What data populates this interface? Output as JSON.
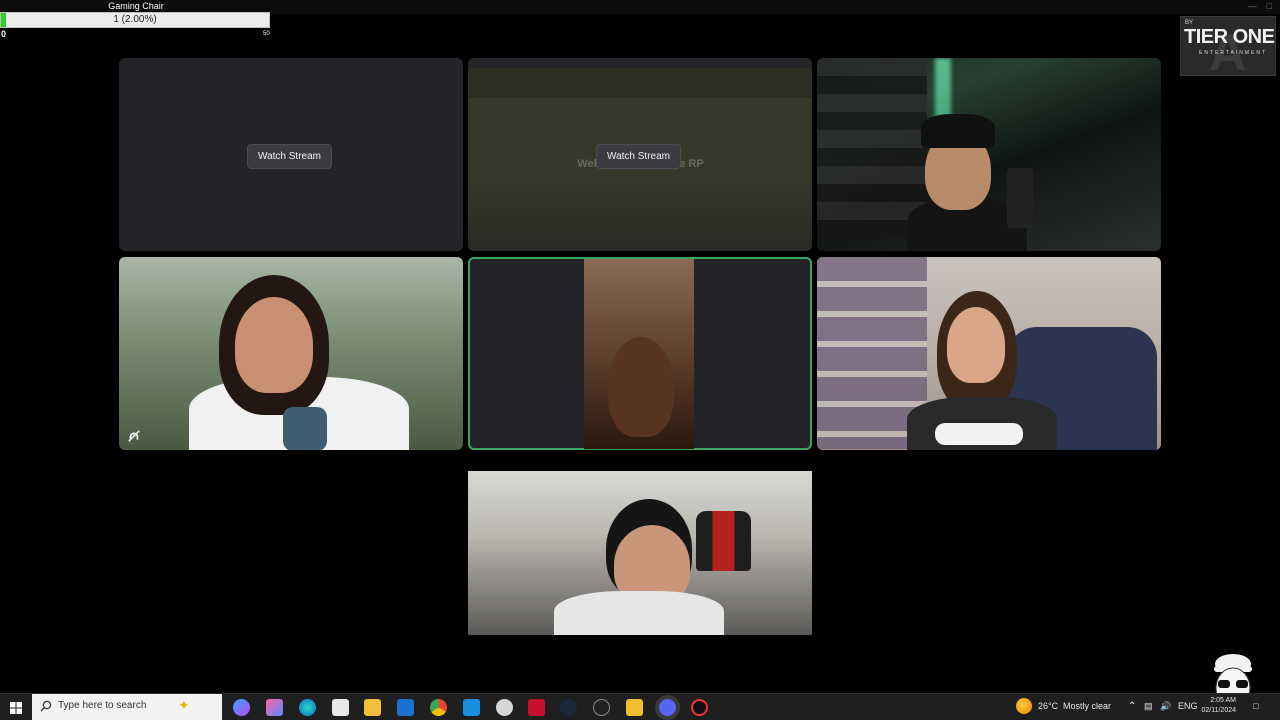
{
  "goal": {
    "title": "Gaming Chair",
    "progress_text": "1 (2.00%)",
    "progress_fraction": 0.02,
    "min_label": "0",
    "max_label": "50"
  },
  "logo": {
    "by": "BY",
    "main": "TIER ONE",
    "sub": "ENTERTAINMENT"
  },
  "tiles": {
    "stream1_button": "Watch Stream",
    "stream2_button": "Watch Stream",
    "stream2_bg_text": "Welcome to Prestige RP"
  },
  "taskbar": {
    "search_placeholder": "Type here to search",
    "weather_temp": "26°C",
    "weather_desc": "Mostly clear",
    "language": "ENG",
    "time": "2:05 AM",
    "date": "02/11/2024"
  },
  "colors": {
    "speaking_border": "#3ba55d",
    "goal_fill": "#2bd12b",
    "tile_bg": "#232428"
  }
}
